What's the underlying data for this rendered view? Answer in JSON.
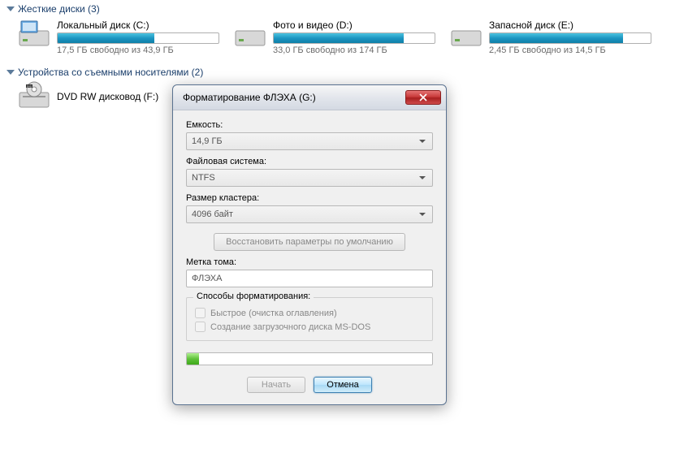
{
  "sections": {
    "hdd": {
      "title": "Жесткие диски (3)"
    },
    "removable": {
      "title": "Устройства со съемными носителями (2)"
    }
  },
  "drives": [
    {
      "label": "Локальный диск (C:)",
      "status": "17,5 ГБ свободно из 43,9 ГБ",
      "fill_pct": 60
    },
    {
      "label": "Фото и видео (D:)",
      "status": "33,0 ГБ свободно из 174 ГБ",
      "fill_pct": 81
    },
    {
      "label": "Запасной диск (E:)",
      "status": "2,45 ГБ свободно из 14,5 ГБ",
      "fill_pct": 83
    }
  ],
  "dvd": {
    "label": "DVD RW дисковод (F:)"
  },
  "dialog": {
    "title": "Форматирование ФЛЭХА (G:)",
    "capacity_label": "Емкость:",
    "capacity_value": "14,9 ГБ",
    "fs_label": "Файловая система:",
    "fs_value": "NTFS",
    "cluster_label": "Размер кластера:",
    "cluster_value": "4096 байт",
    "restore_defaults": "Восстановить параметры по умолчанию",
    "volume_label": "Метка тома:",
    "volume_value": "ФЛЭХА",
    "methods_legend": "Способы форматирования:",
    "quick_label": "Быстрое (очистка оглавления)",
    "msdos_label": "Создание загрузочного диска MS-DOS",
    "start_btn": "Начать",
    "cancel_btn": "Отмена",
    "progress_pct": 5
  }
}
